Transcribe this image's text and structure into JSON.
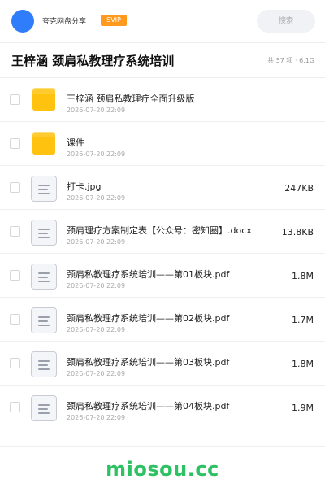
{
  "header": {
    "account_name": "夸克网盘分享",
    "badge": "SVIP",
    "search_placeholder": "搜索"
  },
  "folder": {
    "title": "王梓涵 颈肩私教理疗系统培训",
    "summary": "共 57 项 · 6.1G"
  },
  "files": [
    {
      "type": "folder",
      "name": "王梓涵 颈肩私教理疗全面升级版",
      "date": "2026-07-20 22:09",
      "size": ""
    },
    {
      "type": "folder",
      "name": "课件",
      "date": "2026-07-20 22:09",
      "size": ""
    },
    {
      "type": "file",
      "name": "打卡.jpg",
      "date": "2026-07-20 22:09",
      "size": "247KB"
    },
    {
      "type": "file",
      "name": "颈肩理疗方案制定表【公众号：密知圈】.docx",
      "date": "2026-07-20 22:09",
      "size": "13.8KB"
    },
    {
      "type": "file",
      "name": "颈肩私教理疗系统培训——第01板块.pdf",
      "date": "2026-07-20 22:09",
      "size": "1.8M"
    },
    {
      "type": "file",
      "name": "颈肩私教理疗系统培训——第02板块.pdf",
      "date": "2026-07-20 22:09",
      "size": "1.7M"
    },
    {
      "type": "file",
      "name": "颈肩私教理疗系统培训——第03板块.pdf",
      "date": "2026-07-20 22:09",
      "size": "1.8M"
    },
    {
      "type": "file",
      "name": "颈肩私教理疗系统培训——第04板块.pdf",
      "date": "2026-07-20 22:09",
      "size": "1.9M"
    }
  ],
  "watermark": "miosou.cc",
  "colors": {
    "avatar": "#2f7dfa",
    "badge": "#ff9a1f",
    "folder": "#ffc20e",
    "watermark": "#2ec163"
  },
  "icons": {
    "folder": "folder-icon",
    "file": "document-icon"
  }
}
